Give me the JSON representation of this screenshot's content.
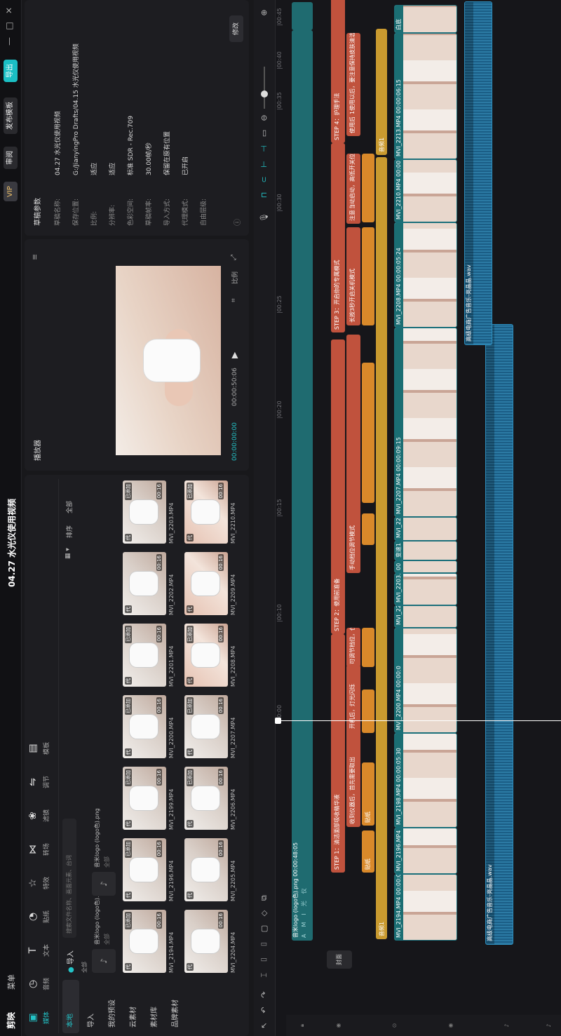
{
  "titlebar": {
    "logo": "剪映",
    "menu": "菜单",
    "project_title": "04.27 水光仪使用视频",
    "vip": "VIP",
    "review_label": "审阅",
    "publish_label": "发布模板",
    "export_label": "导出"
  },
  "toolbar": [
    {
      "icon": "media-icon",
      "label": "媒体"
    },
    {
      "icon": "audio-icon",
      "label": "音频"
    },
    {
      "icon": "text-icon",
      "label": "文本"
    },
    {
      "icon": "sticker-icon",
      "label": "贴纸"
    },
    {
      "icon": "effects-icon",
      "label": "特效"
    },
    {
      "icon": "transition-icon",
      "label": "转场"
    },
    {
      "icon": "filter-icon",
      "label": "滤镜"
    },
    {
      "icon": "adjust-icon",
      "label": "调节"
    },
    {
      "icon": "template-icon",
      "label": "模板"
    }
  ],
  "media_sidebar": [
    "本地",
    "导入",
    "我的预设",
    "云素材",
    "素材库",
    "品牌素材"
  ],
  "media": {
    "import_label": "导入",
    "search_placeholder": "搜索文件名称、画面元素、台词",
    "filter_all": "全部",
    "sort_label": "排序",
    "view_label": "全部",
    "audio_items": [
      {
        "name": "音米logo (logo色).png",
        "type": "全部"
      },
      {
        "name": "音米logo (logo色).png",
        "type": "全部"
      }
    ],
    "thumbs": [
      {
        "name": "MVI_2194.MP4",
        "used": "已添加",
        "skin": false
      },
      {
        "name": "MVI_2196.MP4",
        "used": "已添加",
        "skin": false
      },
      {
        "name": "MVI_2199.MP4",
        "used": "已添加",
        "skin": false
      },
      {
        "name": "MVI_2200.MP4",
        "used": "已添加",
        "skin": false
      },
      {
        "name": "MVI_2201.MP4",
        "used": "已添加",
        "skin": false
      },
      {
        "name": "MVI_2202.MP4",
        "used": "",
        "skin": false
      },
      {
        "name": "MVI_2203.MP4",
        "used": "已添加",
        "skin": false
      },
      {
        "name": "MVI_2204.MP4",
        "used": "",
        "skin": false
      },
      {
        "name": "MVI_2205.MP4",
        "used": "",
        "skin": false
      },
      {
        "name": "MVI_2206.MP4",
        "used": "已添加",
        "skin": false
      },
      {
        "name": "MVI_2207.MP4",
        "used": "已添加",
        "skin": false
      },
      {
        "name": "MVI_2208.MP4",
        "used": "已添加",
        "skin": true
      },
      {
        "name": "MVI_2209.MP4",
        "used": "",
        "skin": true
      },
      {
        "name": "MVI_2210.MP4",
        "used": "已添加",
        "skin": true
      }
    ],
    "thumb_duration": "00:16"
  },
  "player": {
    "title": "播放器",
    "current_time": "00:00:00:00",
    "total_time": "00:00:50:06",
    "ratio_label": "比例"
  },
  "draft": {
    "title": "草稿参数",
    "rows": [
      {
        "k": "草稿名称:",
        "v": "04.27 水光仪使用视频"
      },
      {
        "k": "保存位置:",
        "v": "G:/JianyingPro Drafts/04.15 水光仪使用视频"
      },
      {
        "k": "比例:",
        "v": "适应"
      },
      {
        "k": "分辨率:",
        "v": "适应"
      },
      {
        "k": "色彩空间:",
        "v": "标准 SDR - Rec.709"
      },
      {
        "k": "草稿帧率:",
        "v": "30.00帧/秒"
      },
      {
        "k": "导入方式:",
        "v": "保留在原有位置"
      },
      {
        "k": "代理模式:",
        "v": "已开启"
      },
      {
        "k": "自由层级:",
        "v": ""
      }
    ],
    "modify_label": "修改"
  },
  "timeline": {
    "ruler": [
      "00:00",
      "|00:10",
      "|00:15",
      "|00:20",
      "|00:25",
      "|00:30",
      "|00:35",
      "|00:40",
      "|00:45"
    ],
    "cover_label": "封面",
    "logo_clip": "音米logo (logo色).png  00:00:48:05",
    "logo_wave": "AMI光仪",
    "text_clips": [
      {
        "t": "STEP 1：清洁面部吸收精华液",
        "l": 233,
        "w": 340
      },
      {
        "t": "STEP 2：使用前准备",
        "l": 573,
        "w": 420
      },
      {
        "t": "STEP 3：开启你的专属模式",
        "l": 1003,
        "w": 270
      },
      {
        "t": "STEP 4：护理手法",
        "l": 1273,
        "w": 220
      }
    ],
    "sub_clips": [
      {
        "t": "收到仪器后，首先需要取出",
        "l": 298,
        "w": 170
      },
      {
        "t": "开机后，灯光闪烁",
        "l": 434,
        "w": 95
      },
      {
        "t": "可调节档位，仪器",
        "l": 526,
        "w": 56
      },
      {
        "t": "手动档位调节模式",
        "l": 660,
        "w": 340
      },
      {
        "t": "长按3秒开启关机模式",
        "l": 1013,
        "w": 140
      },
      {
        "t": "仪器自动启动，高低开关位",
        "l": 1158,
        "w": 100
      },
      {
        "t": "注意",
        "l": 1158,
        "w": 22
      },
      {
        "t": "使用后，保持与皮肤的距离约0.5cm",
        "l": 1283,
        "w": 110
      },
      {
        "t": "1使用以后，要注意保持皮肤清洁，注意要及时补水，进行护理",
        "l": 1310,
        "w": 120
      }
    ],
    "sticker_clips": [
      {
        "t": "贴纸",
        "l": 233,
        "w": 60
      },
      {
        "t": "贴纸",
        "l": 300,
        "w": 90
      },
      {
        "t": "",
        "l": 432,
        "w": 62
      },
      {
        "t": "",
        "l": 526,
        "w": 56
      },
      {
        "t": "",
        "l": 700,
        "w": 45
      },
      {
        "t": "",
        "l": 760,
        "w": 200
      },
      {
        "t": "",
        "l": 1013,
        "w": 140
      },
      {
        "t": "",
        "l": 1160,
        "w": 98
      }
    ],
    "yellow_clips": [
      {
        "t": "音频1",
        "l": 138,
        "w": 1115
      },
      {
        "t": "音频1",
        "l": 1256,
        "w": 180
      }
    ],
    "video_clips": [
      {
        "t": "MVI_2194.MP4  00:00:03",
        "l": 136,
        "w": 95
      },
      {
        "t": "MVI_2196.MP4",
        "l": 231,
        "w": 66
      },
      {
        "t": "MVI_2198.MP4  00:00:05:30",
        "l": 297,
        "w": 135
      },
      {
        "t": "MVI_2200.MP4  00:00:0",
        "l": 432,
        "w": 150
      },
      {
        "t": "MVI_2201.M",
        "l": 582,
        "w": 32
      },
      {
        "t": "MVI_2203.MP4",
        "l": 614,
        "w": 46
      },
      {
        "t": "00",
        "l": 660,
        "w": 18
      },
      {
        "t": "变速1",
        "l": 678,
        "w": 28
      },
      {
        "t": "MVI_2206",
        "l": 706,
        "w": 34
      },
      {
        "t": "MVI_2207.MP4  00:00:09:15",
        "l": 740,
        "w": 270
      },
      {
        "t": "MVI_2208.MP4  00:00:05:24",
        "l": 1010,
        "w": 150
      },
      {
        "t": "MVI_2210.MP4  00:00",
        "l": 1160,
        "w": 90
      },
      {
        "t": "MVI_2213.MP4  00:00:06:15",
        "l": 1250,
        "w": 180
      },
      {
        "t": "白底",
        "l": 1430,
        "w": 40
      }
    ],
    "music_clips": [
      {
        "t": "高级电商广告音乐-亮晶晶.wav",
        "l": 130,
        "w": 885
      },
      {
        "t": "高级电商广告音乐-亮晶晶.wav",
        "l": 985,
        "w": 490
      }
    ]
  }
}
